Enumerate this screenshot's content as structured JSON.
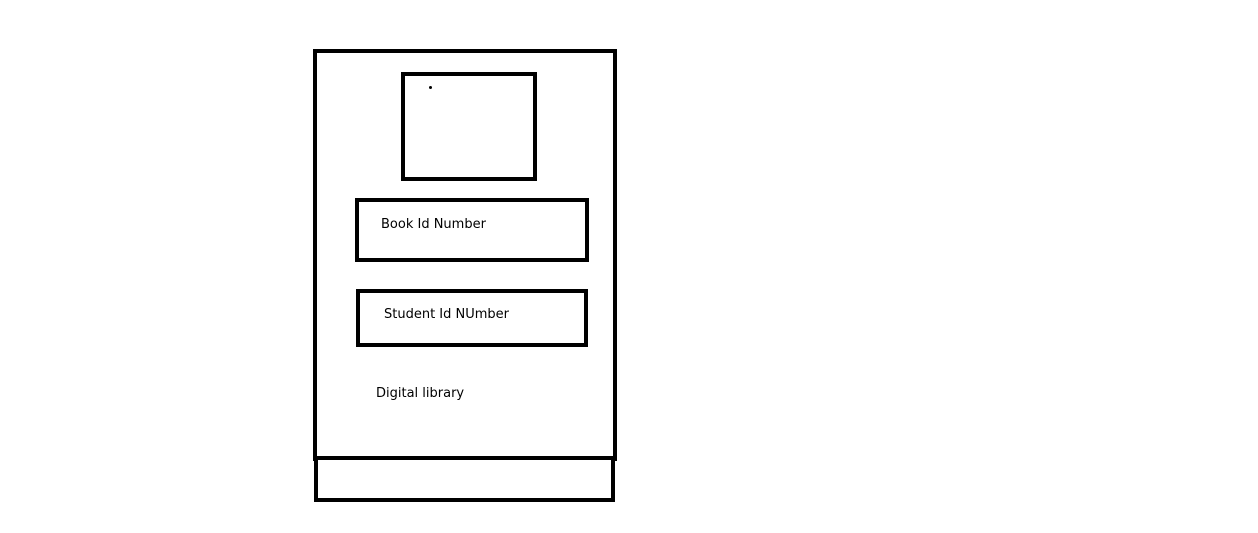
{
  "form": {
    "book_id_label": "Book Id Number",
    "student_id_label": "Student Id NUmber",
    "caption": "Digital library"
  }
}
